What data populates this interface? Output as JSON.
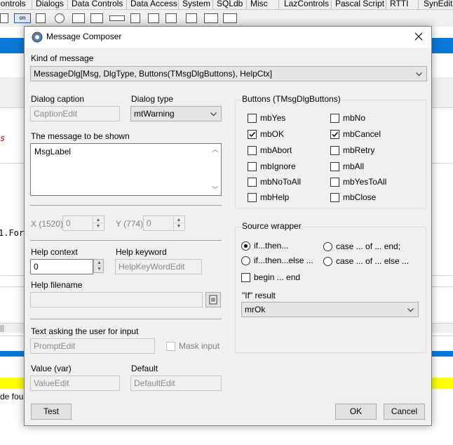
{
  "background": {
    "palette_tabs": [
      {
        "label": "Controls",
        "x_hint": "cut"
      },
      {
        "label": "Dialogs"
      },
      {
        "label": "Data Controls"
      },
      {
        "label": "Data Access"
      },
      {
        "label": "System"
      },
      {
        "label": "SQLdb"
      },
      {
        "label": "Misc"
      },
      {
        "label": "LazControls"
      },
      {
        "label": "Pascal Script"
      },
      {
        "label": "RTTI"
      },
      {
        "label": "SynEdit"
      }
    ],
    "code_fragment_1": "s",
    "code_fragment_2": "1.For",
    "status_fragment": "de four"
  },
  "dialog": {
    "title": "Message Composer",
    "kind_label": "Kind of message",
    "kind_value": "MessageDlg[Msg, DlgType, Buttons(TMsgDlgButtons), HelpCtx]",
    "caption_label": "Dialog caption",
    "caption_placeholder": "CaptionEdit",
    "type_label": "Dialog type",
    "type_value": "mtWarning",
    "message_label": "The message to be shown",
    "message_value": "MsgLabel",
    "x_label": "X (1520)",
    "x_value": "0",
    "y_label": "Y (774)",
    "y_value": "0",
    "help_context_label": "Help context",
    "help_context_value": "0",
    "help_keyword_label": "Help keyword",
    "help_keyword_placeholder": "HelpKeyWordEdit",
    "help_filename_label": "Help filename",
    "input_prompt_label": "Text asking the user for input",
    "prompt_placeholder": "PromptEdit",
    "mask_input_label": "Mask input",
    "value_label": "Value (var)",
    "value_placeholder": "ValueEdit",
    "default_label": "Default",
    "default_placeholder": "DefaultEdit",
    "buttons_group_title": "Buttons (TMsgDlgButtons)",
    "buttons": [
      {
        "label": "mbYes",
        "checked": false
      },
      {
        "label": "mbNo",
        "checked": false
      },
      {
        "label": "mbOK",
        "checked": true
      },
      {
        "label": "mbCancel",
        "checked": true
      },
      {
        "label": "mbAbort",
        "checked": false
      },
      {
        "label": "mbRetry",
        "checked": false
      },
      {
        "label": "mbIgnore",
        "checked": false
      },
      {
        "label": "mbAll",
        "checked": false
      },
      {
        "label": "mbNoToAll",
        "checked": false
      },
      {
        "label": "mbYesToAll",
        "checked": false
      },
      {
        "label": "mbHelp",
        "checked": false
      },
      {
        "label": "mbClose",
        "checked": false
      }
    ],
    "source_wrapper_title": "Source wrapper",
    "wrapper_options": [
      {
        "label": "if...then...",
        "selected": true
      },
      {
        "label": "case ... of ... end;",
        "selected": false
      },
      {
        "label": "if...then...else ...",
        "selected": false
      },
      {
        "label": "case ... of ... else ...",
        "selected": false
      }
    ],
    "begin_end_label": "begin ... end",
    "if_result_label": "\"If\" result",
    "if_result_value": "mrOk",
    "test_button": "Test",
    "ok_button": "OK",
    "cancel_button": "Cancel",
    "colors": {
      "accent": "#0a78d7",
      "highlight": "#ffff00",
      "dialog_bg": "#f0f0f0"
    }
  }
}
